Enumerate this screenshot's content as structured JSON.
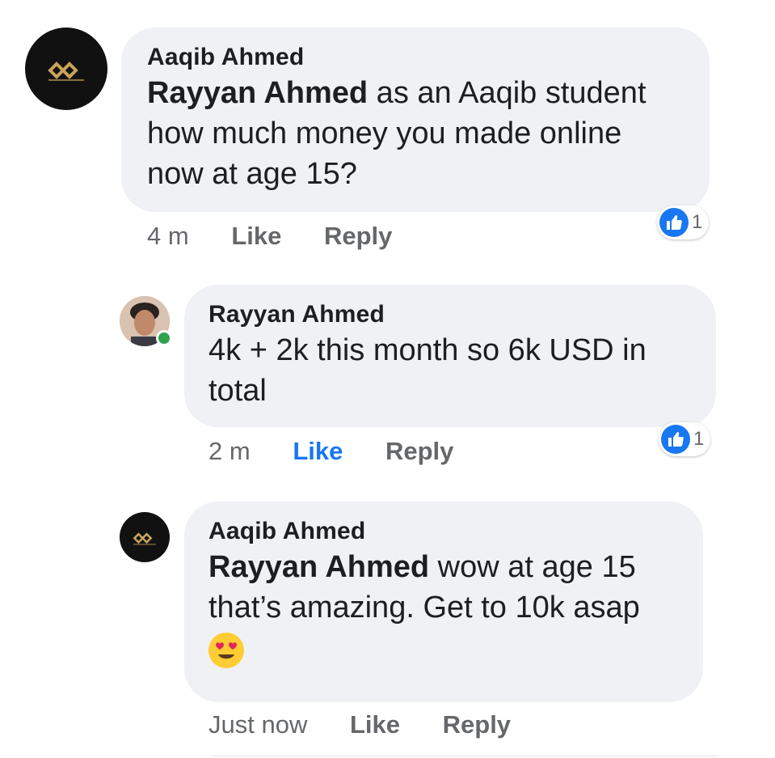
{
  "comments": [
    {
      "author": "Aaqib Ahmed",
      "mention": "Rayyan Ahmed",
      "line1": " as an Aaqib student",
      "line2": "how much money you made online",
      "line3": "now at age 15?",
      "time": "4 m",
      "like_label": "Like",
      "reply_label": "Reply",
      "reaction_count": "1"
    },
    {
      "author": "Rayyan Ahmed",
      "line1": "4k + 2k this month so 6k USD in",
      "line2": "total",
      "time": "2 m",
      "like_label": "Like",
      "reply_label": "Reply",
      "reaction_count": "1",
      "liked": true
    },
    {
      "author": "Aaqib Ahmed",
      "mention": "Rayyan Ahmed",
      "line1": " wow at age 15",
      "line2": "that’s amazing. Get to 10k asap",
      "emoji": "heart-eyes-emoji",
      "time": "Just now",
      "like_label": "Like",
      "reply_label": "Reply"
    }
  ],
  "icons": {
    "like": "thumbs-up-icon",
    "online": "online-status-dot"
  },
  "colors": {
    "bubble": "#eff1f4",
    "like_blue": "#1877f2",
    "meta_gray": "#65676b",
    "online_green": "#31a24c"
  }
}
